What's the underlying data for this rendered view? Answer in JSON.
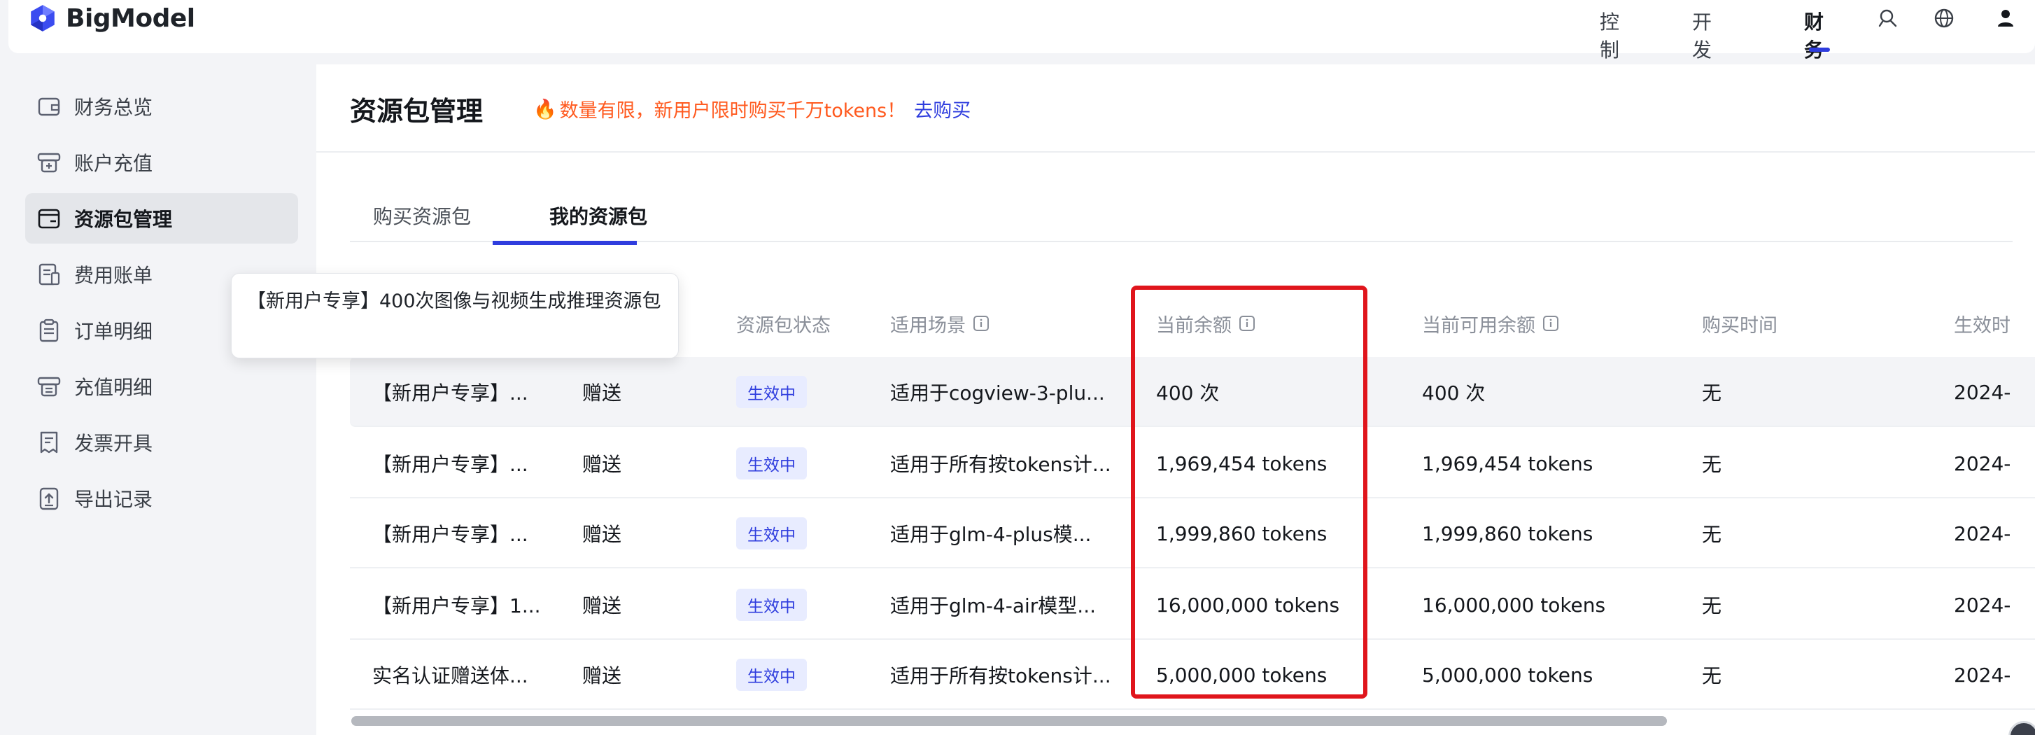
{
  "app": {
    "logo_text": "BigModel",
    "nav": {
      "console": "控制台",
      "docs": "开发文档",
      "finance": "财务"
    }
  },
  "sidebar": {
    "items": [
      {
        "label": "财务总览",
        "icon": "wallet-icon"
      },
      {
        "label": "账户充值",
        "icon": "recharge-icon"
      },
      {
        "label": "资源包管理",
        "icon": "package-icon",
        "active": true
      },
      {
        "label": "费用账单",
        "icon": "bill-icon"
      },
      {
        "label": "订单明细",
        "icon": "order-icon"
      },
      {
        "label": "充值明细",
        "icon": "recharge-detail-icon"
      },
      {
        "label": "发票开具",
        "icon": "invoice-icon"
      },
      {
        "label": "导出记录",
        "icon": "export-icon"
      }
    ]
  },
  "main": {
    "title": "资源包管理",
    "promo": {
      "fire": "🔥",
      "text": "数量有限，新用户限时购买千万tokens！",
      "link": "去购买"
    },
    "tabs": [
      {
        "label": "购买资源包"
      },
      {
        "label": "我的资源包",
        "active": true
      }
    ]
  },
  "table": {
    "headers": {
      "status": "资源包状态",
      "scene": "适用场景",
      "balance": "当前余额",
      "available": "当前可用余额",
      "purchase_time": "购买时间",
      "effective": "生效时"
    },
    "rows": [
      {
        "name": "【新用户专享】...",
        "source": "赠送",
        "status": "生效中",
        "scene": "适用于cogview-3-plu...",
        "balance": "400 次",
        "available": "400 次",
        "purchase_time": "无",
        "effective": "2024-"
      },
      {
        "name": "【新用户专享】...",
        "source": "赠送",
        "status": "生效中",
        "scene": "适用于所有按tokens计...",
        "balance": "1,969,454 tokens",
        "available": "1,969,454 tokens",
        "purchase_time": "无",
        "effective": "2024-"
      },
      {
        "name": "【新用户专享】...",
        "source": "赠送",
        "status": "生效中",
        "scene": "适用于glm-4-plus模...",
        "balance": "1,999,860 tokens",
        "available": "1,999,860 tokens",
        "purchase_time": "无",
        "effective": "2024-"
      },
      {
        "name": "【新用户专享】1...",
        "source": "赠送",
        "status": "生效中",
        "scene": "适用于glm-4-air模型...",
        "balance": "16,000,000 tokens",
        "available": "16,000,000 tokens",
        "purchase_time": "无",
        "effective": "2024-"
      },
      {
        "name": "实名认证赠送体...",
        "source": "赠送",
        "status": "生效中",
        "scene": "适用于所有按tokens计...",
        "balance": "5,000,000 tokens",
        "available": "5,000,000 tokens",
        "purchase_time": "无",
        "effective": "2024-"
      }
    ]
  },
  "tooltip": {
    "text": "【新用户专享】400次图像与视频生成推理资源包"
  },
  "colors": {
    "accent": "#2f3dde",
    "promo": "#ff5a1f",
    "highlight": "#e0151c",
    "badge_bg": "#e8ecff"
  }
}
